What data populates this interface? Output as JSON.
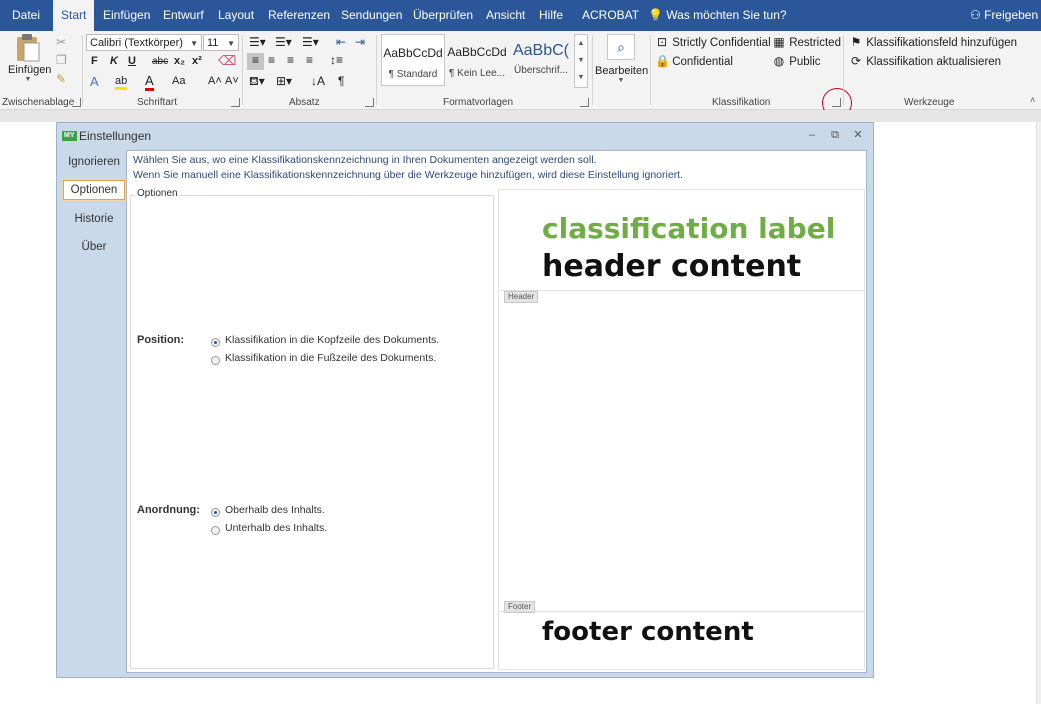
{
  "menu": {
    "tabs": [
      "Datei",
      "Start",
      "Einfügen",
      "Entwurf",
      "Layout",
      "Referenzen",
      "Sendungen",
      "Überprüfen",
      "Ansicht",
      "Hilfe",
      "ACROBAT"
    ],
    "tell_me": "Was möchten Sie tun?",
    "share": "Freigeben"
  },
  "ribbon": {
    "clipboard": {
      "paste": "Einfügen",
      "label": "Zwischenablage"
    },
    "font": {
      "name": "Calibri (Textkörper)",
      "size": "11",
      "label": "Schriftart",
      "bold": "F",
      "italic": "K",
      "underline": "U",
      "strike": "abc",
      "sub": "x₂",
      "sup": "x²",
      "grow": "A˄",
      "shrink": "A˅",
      "case": "Aa"
    },
    "paragraph": {
      "label": "Absatz",
      "pilcrow": "¶"
    },
    "styles": {
      "label": "Formatvorlagen",
      "items": [
        {
          "preview": "AaBbCcDd",
          "name": "¶ Standard"
        },
        {
          "preview": "AaBbCcDd",
          "name": "¶ Kein Lee..."
        },
        {
          "preview": "AaBbC(",
          "name": "Überschrif..."
        }
      ]
    },
    "editing": {
      "label": "Bearbeiten"
    },
    "classification": {
      "label": "Klassifikation",
      "items": [
        "Strictly Confidential",
        "Restricted",
        "Confidential",
        "Public"
      ]
    },
    "tools": {
      "label": "Werkzeuge",
      "items": [
        "Klassifikationsfeld hinzufügen",
        "Klassifikation aktualisieren"
      ]
    }
  },
  "dialog": {
    "app_badge": "MY",
    "title": "Einstellungen",
    "nav": [
      "Ignorieren",
      "Optionen",
      "Historie",
      "Über"
    ],
    "intro_line1": "Wählen Sie aus, wo eine Klassifikationskennzeichnung in Ihren Dokumenten angezeigt werden soll.",
    "intro_line2": "Wenn Sie manuell eine Klassifikationskennzeichnung über die Werkzeuge hinzufügen, wird diese Einstellung ignoriert.",
    "options_group": "Optionen",
    "position": {
      "label": "Position:",
      "options": [
        "Klassifikation in die Kopfzeile des Dokuments.",
        "Klassifikation in die Fußzeile des Dokuments."
      ],
      "selected": 0
    },
    "order": {
      "label": "Anordnung:",
      "options": [
        "Oberhalb des Inhalts.",
        "Unterhalb des Inhalts."
      ],
      "selected": 0
    },
    "preview": {
      "classification_label": "classification label",
      "header_content": "header content",
      "header_tag": "Header",
      "footer_tag": "Footer",
      "footer_content": "footer content"
    }
  },
  "colors": {
    "brand": "#2b579a",
    "label_green": "#70ad47",
    "highlight_circle": "#d0021b"
  }
}
